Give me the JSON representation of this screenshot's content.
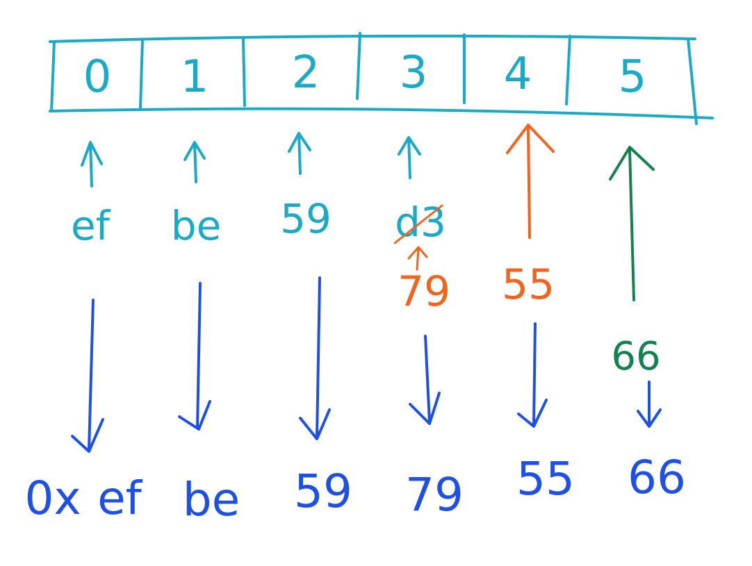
{
  "colors": {
    "cyan": "#1aaac8",
    "orange": "#f0641e",
    "green": "#148250",
    "blue": "#1e50e6"
  },
  "cells": [
    {
      "index": "0"
    },
    {
      "index": "1"
    },
    {
      "index": "2"
    },
    {
      "index": "3"
    },
    {
      "index": "4"
    },
    {
      "index": "5"
    }
  ],
  "stored_bytes": {
    "first_write": [
      "ef",
      "be",
      "59",
      "d3"
    ],
    "overwrite_3": "79",
    "write_4": "55",
    "write_5": "66"
  },
  "result": {
    "prefix": "0x",
    "bytes": [
      "ef",
      "be",
      "59",
      "79",
      "55",
      "66"
    ]
  }
}
